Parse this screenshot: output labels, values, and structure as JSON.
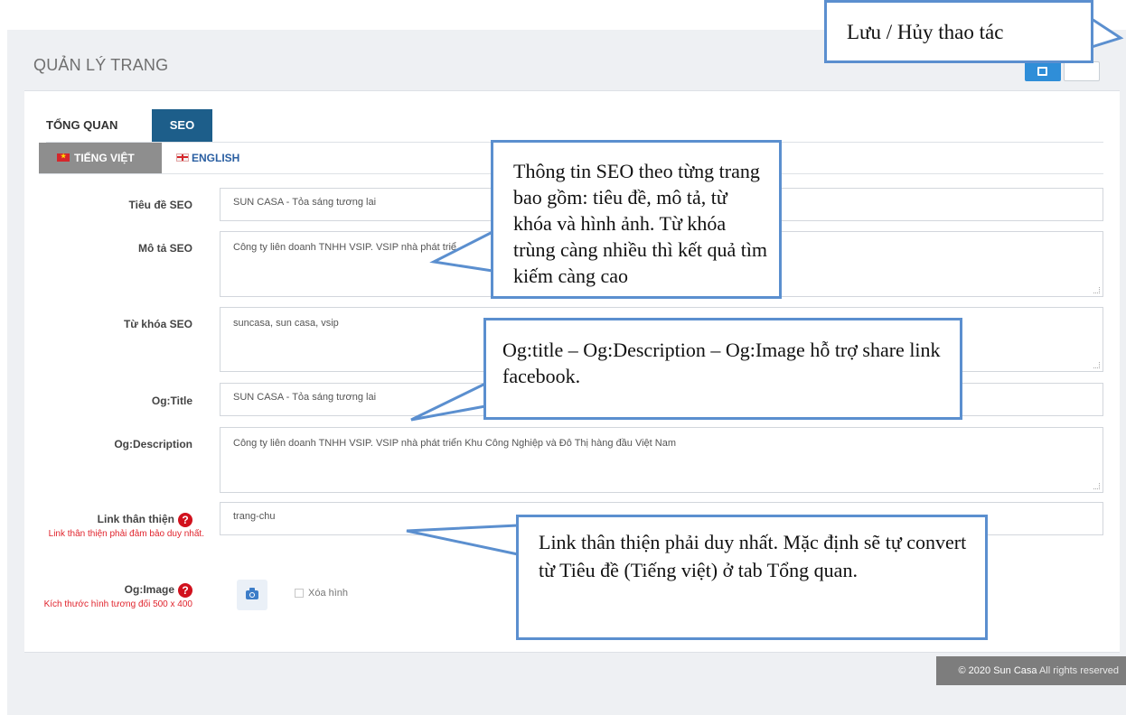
{
  "header": {
    "page_title": "QUẢN LÝ TRANG"
  },
  "tabs": [
    {
      "label": "TỔNG QUAN"
    },
    {
      "label": "SEO"
    }
  ],
  "lang_tabs": [
    {
      "label": "TIẾNG VIỆT"
    },
    {
      "label": "ENGLISH"
    }
  ],
  "form": {
    "seo_title": {
      "label": "Tiêu đề SEO",
      "value": "SUN CASA - Tỏa sáng tương lai"
    },
    "seo_description": {
      "label": "Mô tả SEO",
      "value": "Công ty liên doanh TNHH VSIP. VSIP nhà phát triể"
    },
    "seo_keywords": {
      "label": "Từ khóa SEO",
      "value": "suncasa, sun casa, vsip"
    },
    "og_title": {
      "label": "Og:Title",
      "value": "SUN CASA - Tỏa sáng tương lai"
    },
    "og_description": {
      "label": "Og:Description",
      "value": "Công ty liên doanh TNHH VSIP. VSIP nhà phát triển Khu Công Nghiệp và Đô Thị hàng đầu Việt Nam"
    },
    "friendly_link": {
      "label": "Link thân thiện",
      "hint": "Link thân thiện phải đảm bảo duy nhất.",
      "value": "trang-chu"
    },
    "og_image": {
      "label": "Og:Image",
      "hint": "Kích thước hình tương đối 500 x 400",
      "delete_label": "Xóa hình"
    }
  },
  "footer": {
    "year_brand": "© 2020 Sun Casa",
    "rights": " All rights reserved"
  },
  "callouts": {
    "save_cancel": "Lưu / Hủy thao tác",
    "seo_info": "Thông tin SEO theo từng trang bao gồm: tiêu đề, mô tả, từ khóa và hình ảnh. Từ khóa trùng càng nhiều thì kết quả tìm kiếm càng cao",
    "og_info": "Og:title – Og:Description – Og:Image hỗ trợ share link facebook.",
    "link_info": "Link thân thiện phải duy nhất. Mặc định sẽ tự convert từ Tiêu đề (Tiếng việt) ở tab Tổng quan."
  },
  "colors": {
    "accent": "#1d5e8a",
    "save_button": "#2f8ed8",
    "callout_border": "#5b8fcf",
    "required_red": "#d1111d"
  },
  "icons": [
    "save-icon",
    "help-icon",
    "camera-icon",
    "flag-vn-icon",
    "flag-gb-icon"
  ]
}
